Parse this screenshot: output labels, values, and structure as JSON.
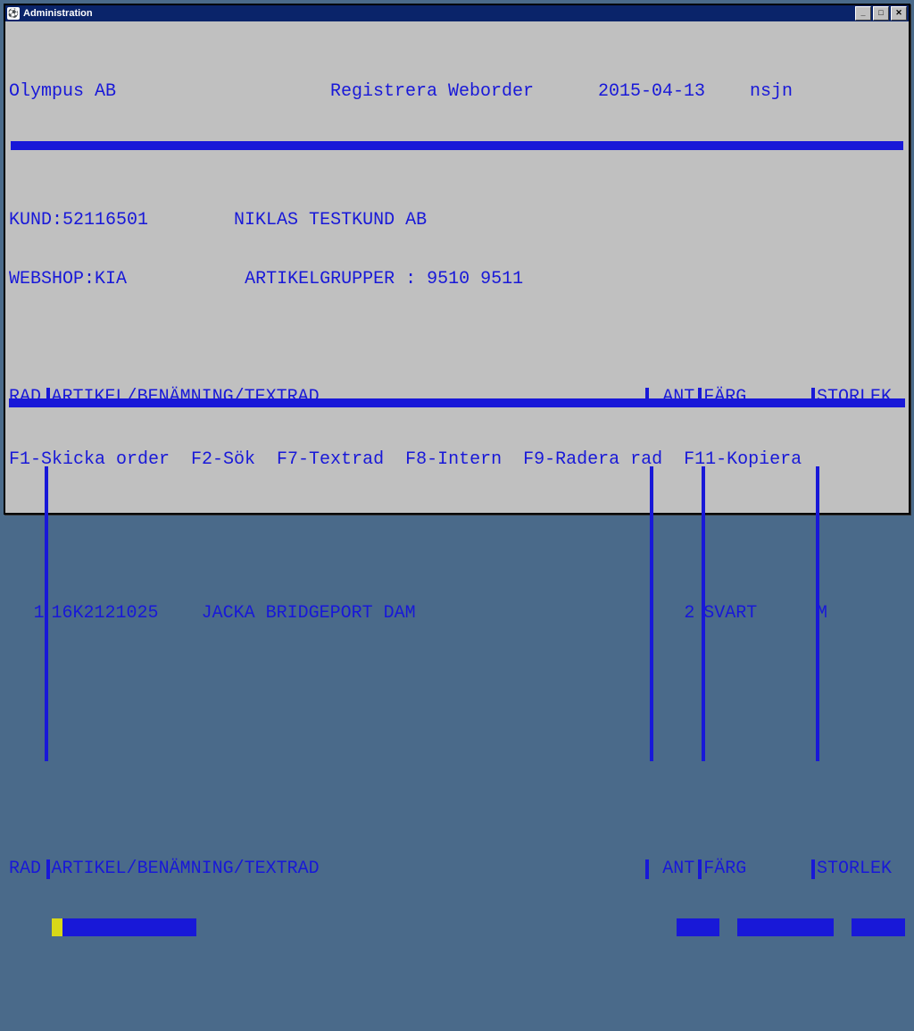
{
  "window": {
    "title": "Administration"
  },
  "header": {
    "company": "Olympus AB",
    "screen": "Registrera Weborder",
    "date": "2015-04-13",
    "user": "nsjn"
  },
  "customer": {
    "kund_label": "KUND:",
    "kund_no": "52116501",
    "kund_name": "NIKLAS TESTKUND AB",
    "webshop_label": "WEBSHOP:",
    "webshop": "KIA",
    "artgrp_label": "ARTIKELGRUPPER :",
    "artgrp": "9510 9511"
  },
  "columns": {
    "rad": "RAD",
    "art": "ARTIKEL/BENÄMNING/TEXTRAD",
    "ant": "ANT",
    "farg": "FÄRG",
    "stor": "STORLEK"
  },
  "rows": [
    {
      "rad": "1",
      "artikel": "16K2121025",
      "benamning": "JACKA BRIDGEPORT DAM",
      "ant": "2",
      "farg": "SVART",
      "stor": "M"
    }
  ],
  "input_columns": {
    "rad": "RAD",
    "art": "ARTIKEL/BENÄMNING/TEXTRAD",
    "ant": "ANT",
    "farg": "FÄRG",
    "stor": "STORLEK"
  },
  "fnkeys": "F1-Skicka order  F2-Sök  F7-Textrad  F8-Intern  F9-Radera rad  F11-Kopiera"
}
